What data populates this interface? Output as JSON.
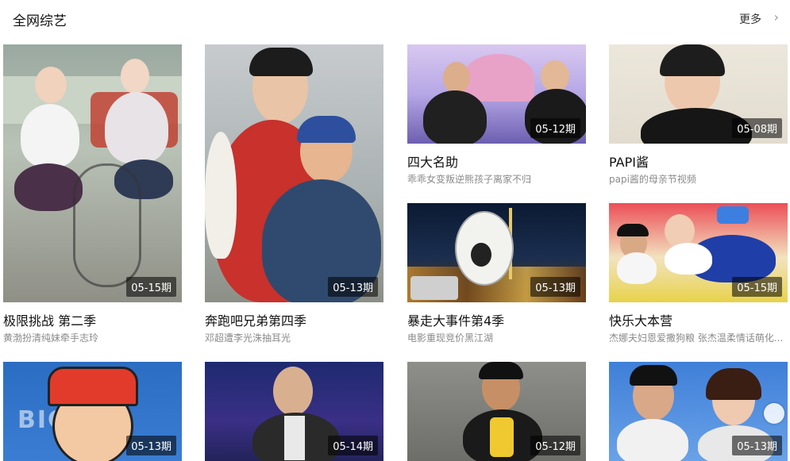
{
  "header": {
    "title": "全网综艺",
    "more_label": "更多",
    "more_icon": "chevron-right-icon"
  },
  "cards": [
    {
      "badge": "05-15期",
      "title": "极限挑战 第二季",
      "subtitle": "黄渤扮清纯妹牵手志玲"
    },
    {
      "badge": "05-13期",
      "title": "奔跑吧兄弟第四季",
      "subtitle": "邓超遭李光洙抽耳光"
    },
    {
      "badge": "05-12期",
      "title": "四大名助",
      "subtitle": "乖乖女变叛逆熊孩子离家不归"
    },
    {
      "badge": "05-08期",
      "title": "PAPI酱",
      "subtitle": "papi酱的母亲节视频"
    },
    {
      "badge": "05-13期",
      "title": "暴走大事件第4季",
      "subtitle": "电影重现竞价黑江湖"
    },
    {
      "badge": "05-15期",
      "title": "快乐大本营",
      "subtitle": "杰娜夫妇恩爱撒狗粮 张杰温柔情话萌化..."
    },
    {
      "badge": "05-13期",
      "title": "",
      "subtitle": ""
    },
    {
      "badge": "05-14期",
      "title": "",
      "subtitle": ""
    },
    {
      "badge": "05-12期",
      "title": "",
      "subtitle": ""
    },
    {
      "badge": "05-13期",
      "title": "",
      "subtitle": ""
    }
  ],
  "row3_left_sign": "BIG 坊"
}
